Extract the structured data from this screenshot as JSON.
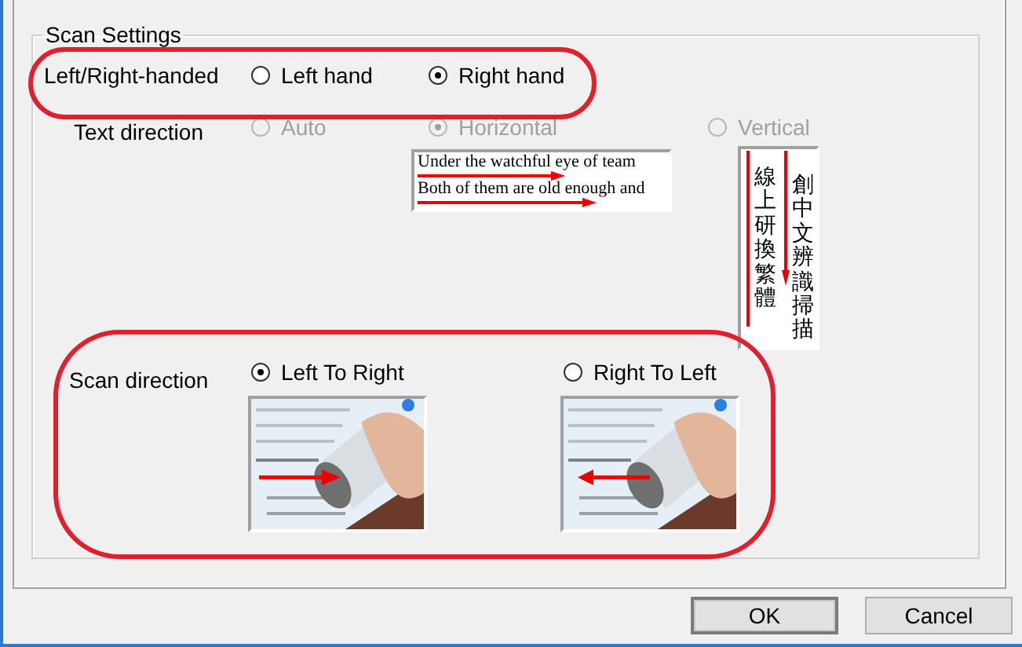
{
  "group": {
    "title": "Scan Settings"
  },
  "handedness": {
    "label": "Left/Right-handed",
    "options": [
      {
        "label": "Left hand",
        "selected": false
      },
      {
        "label": "Right hand",
        "selected": true
      }
    ]
  },
  "text_direction": {
    "label": "Text direction",
    "disabled": true,
    "options": [
      {
        "label": "Auto",
        "selected": false
      },
      {
        "label": "Horizontal",
        "selected": true,
        "sample": {
          "kind": "horizontal",
          "lines": [
            "Under the watchful eye of team",
            "Both of them are old enough and"
          ]
        }
      },
      {
        "label": "Vertical",
        "selected": false,
        "sample": {
          "kind": "vertical",
          "columns": [
            "線上研換繁體",
            "創中文辨識掃描"
          ]
        }
      }
    ]
  },
  "scan_direction": {
    "label": "Scan direction",
    "options": [
      {
        "label": "Left To Right",
        "selected": true,
        "kind": "rightward"
      },
      {
        "label": "Right To Left",
        "selected": false,
        "kind": "leftward"
      }
    ]
  },
  "buttons": [
    {
      "label": "OK",
      "default": true
    },
    {
      "label": "Cancel",
      "default": false
    }
  ]
}
